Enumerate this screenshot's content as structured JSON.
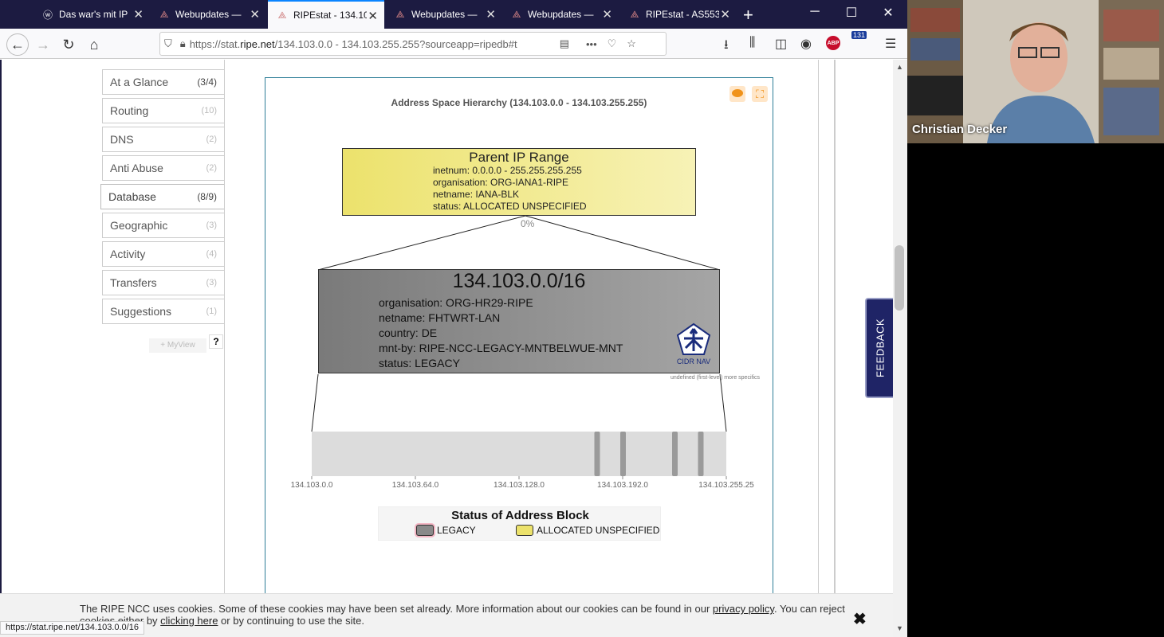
{
  "tabs": [
    {
      "label": "Das war's mit IP",
      "icon": "wordpress-icon",
      "active": false
    },
    {
      "label": "Webupdates —",
      "icon": "ripe-icon",
      "active": false
    },
    {
      "label": "RIPEstat - 134.10",
      "icon": "ripe-icon",
      "active": true
    },
    {
      "label": "Webupdates —",
      "icon": "ripe-icon",
      "active": false
    },
    {
      "label": "Webupdates —",
      "icon": "ripe-icon",
      "active": false
    },
    {
      "label": "RIPEstat - AS553",
      "icon": "ripe-icon",
      "active": false
    }
  ],
  "url": {
    "prefix": "https://stat.",
    "domain": "ripe.net",
    "path": "/134.103.0.0 - 134.103.255.255?sourceapp=ripedb#t"
  },
  "toolbar": {
    "extension_badge": "131",
    "adblock_label": "ABP"
  },
  "menu": {
    "items": [
      {
        "label": "At a Glance",
        "count": "(3/4)"
      },
      {
        "label": "Routing",
        "count": "(10)"
      },
      {
        "label": "DNS",
        "count": "(2)"
      },
      {
        "label": "Anti Abuse",
        "count": "(2)"
      },
      {
        "label": "Database",
        "count": "(8/9)"
      },
      {
        "label": "Geographic",
        "count": "(3)"
      },
      {
        "label": "Activity",
        "count": "(4)"
      },
      {
        "label": "Transfers",
        "count": "(3)"
      },
      {
        "label": "Suggestions",
        "count": "(1)"
      }
    ],
    "myview": "+ MyView",
    "help": "?"
  },
  "widget": {
    "title": "Address Space Hierarchy (134.103.0.0 - 134.103.255.255)",
    "parent": {
      "title": "Parent IP Range",
      "inetnum": "inetnum: 0.0.0.0 - 255.255.255.255",
      "organisation": "organisation: ORG-IANA1-RIPE",
      "netname": "netname: IANA-BLK",
      "status": "status: ALLOCATED UNSPECIFIED"
    },
    "percentage": "0%",
    "child": {
      "title": "134.103.0.0/16",
      "organisation": "organisation: ORG-HR29-RIPE",
      "netname": "netname: FHTWRT-LAN",
      "country": "country: DE",
      "mntby": "mnt-by: RIPE-NCC-LEGACY-MNTBELWUE-MNT",
      "status": "status: LEGACY",
      "cidr_label": "CIDR NAV"
    },
    "note": "undefined (first-level) more specifics",
    "legend": {
      "title": "Status of Address Block",
      "legacy": "LEGACY",
      "allocated": "ALLOCATED UNSPECIFIED",
      "colors": {
        "legacy": "#8a8a8a",
        "allocated": "#ece26c"
      }
    }
  },
  "chart_data": {
    "type": "bar",
    "title": "",
    "tick_labels": [
      "134.103.0.0",
      "134.103.64.0",
      "134.103.128.0",
      "134.103.192.0",
      "134.103.255.25"
    ],
    "range_start": "134.103.0.0",
    "range_end": "134.103.255.255",
    "more_specifics_third_octet": [
      176,
      192,
      224,
      240
    ]
  },
  "feedback_label": "FEEDBACK",
  "cookie": {
    "text_before": "The RIPE NCC uses cookies. Some of these cookies may have been set already. More information about our cookies can be found in our ",
    "privacy_link": "privacy policy",
    "text_middle": ". You can reject cookies either by ",
    "click_link": "clicking here",
    "text_after": " or by continuing to use the site."
  },
  "status_url": "https://stat.ripe.net/134.103.0.0/16",
  "webcam": {
    "name": "Christian Decker"
  }
}
